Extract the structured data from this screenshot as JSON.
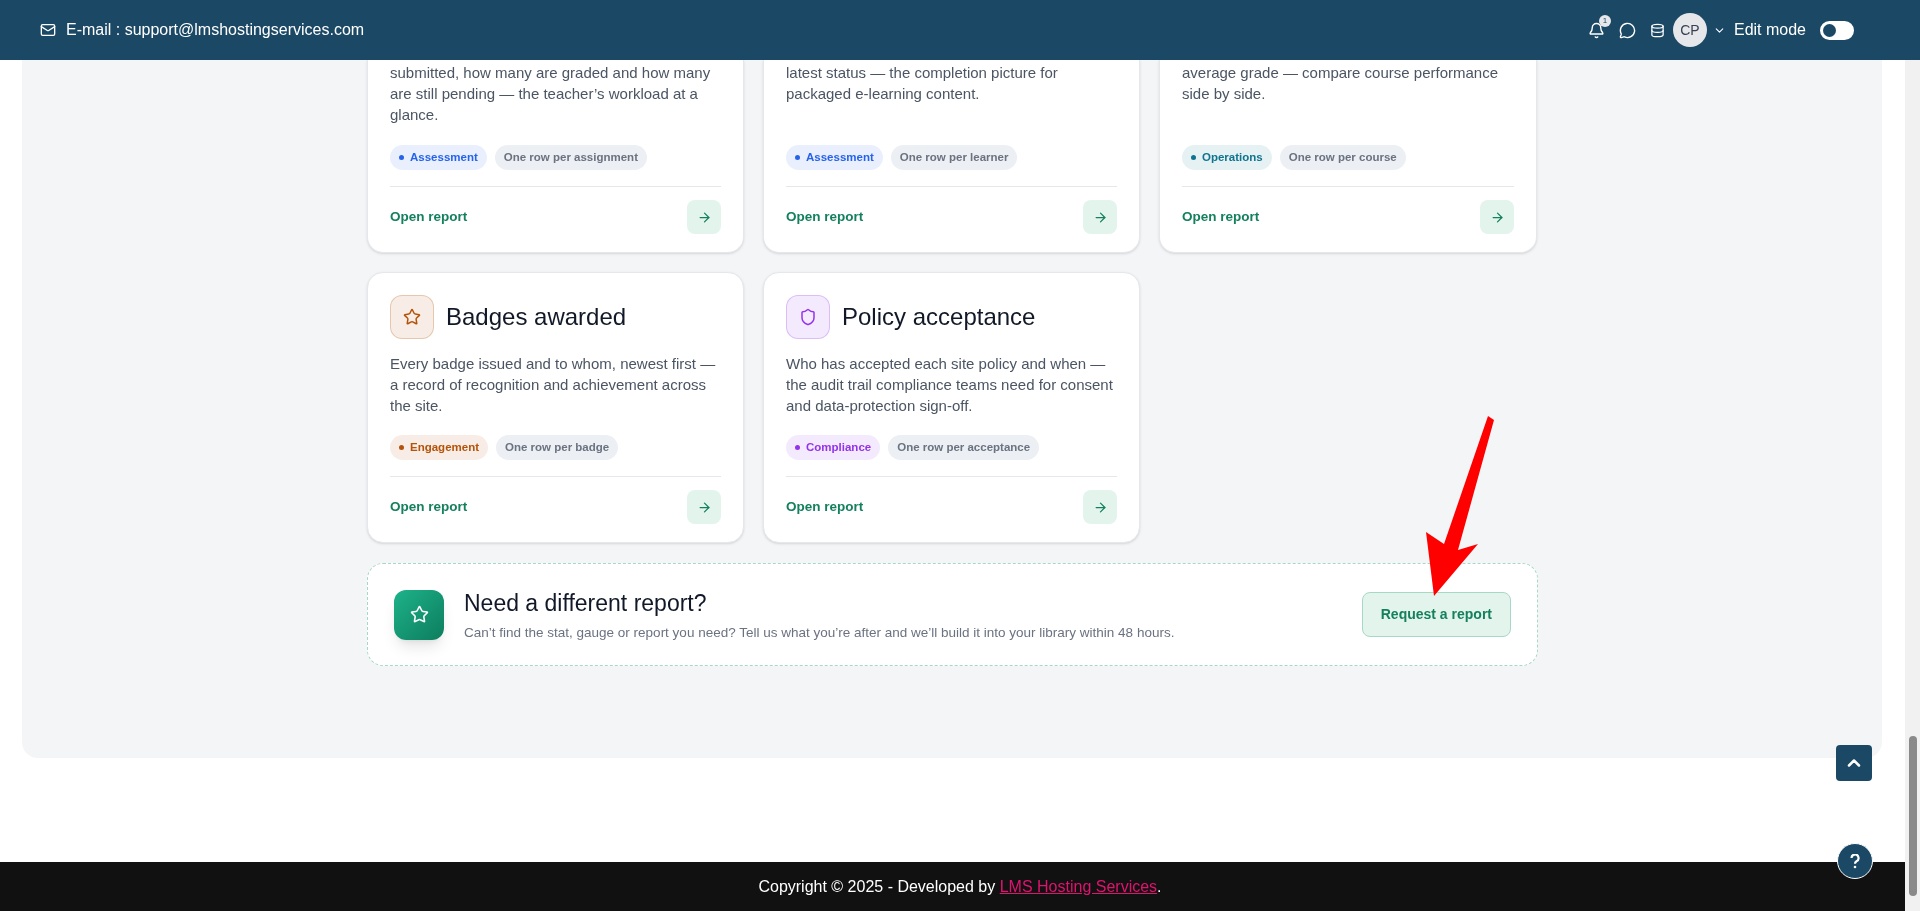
{
  "header": {
    "email": "E-mail : support@lmshostingservices.com",
    "notification_count": "1",
    "avatar": "CP",
    "edit_mode": {
      "label": "Edit mode",
      "on": false
    }
  },
  "reports": [
    {
      "description": "submitted, how many are graded and how many are still pending — the teacher’s workload at a glance.",
      "category": {
        "label": "Assessment",
        "color": "#2563eb"
      },
      "scope": "One row per assignment",
      "link": "Open report"
    },
    {
      "description": "latest status — the completion picture for packaged e-learning content.",
      "category": {
        "label": "Assessment",
        "color": "#2563eb"
      },
      "scope": "One row per learner",
      "link": "Open report"
    },
    {
      "description": "average grade — compare course performance side by side.",
      "category": {
        "label": "Operations",
        "color": "#0e7490"
      },
      "scope": "One row per course",
      "link": "Open report"
    },
    {
      "title": "Badges awarded",
      "kind": "star",
      "description": "Every badge issued and to whom, newest first — a record of recognition and achievement across the site.",
      "category": {
        "label": "Engagement",
        "color": "#b45309"
      },
      "scope": "One row per badge",
      "link": "Open report"
    },
    {
      "title": "Policy acceptance",
      "kind": "shield",
      "description": "Who has accepted each site policy and when — the audit trail compliance teams need for consent and data-protection sign-off.",
      "category": {
        "label": "Compliance",
        "color": "#9333ea"
      },
      "scope": "One row per acceptance",
      "link": "Open report"
    }
  ],
  "request_banner": {
    "title": "Need a different report?",
    "text": "Can’t find the stat, gauge or report you need? Tell us what you’re after and we’ll build it into your library within 48 hours.",
    "button": "Request a report"
  },
  "footer": {
    "text": "Copyright © 2025 - Developed by ",
    "link": "LMS Hosting Services",
    "suffix": "."
  }
}
